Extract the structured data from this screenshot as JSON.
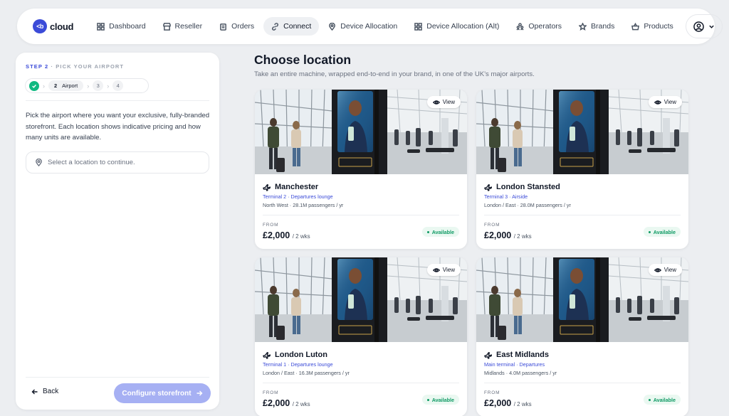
{
  "brand": {
    "logo_mark": "<b",
    "name": "cloud"
  },
  "nav": {
    "items": [
      {
        "label": "Dashboard",
        "icon": "grid-icon"
      },
      {
        "label": "Reseller",
        "icon": "store-icon"
      },
      {
        "label": "Orders",
        "icon": "clipboard-icon"
      },
      {
        "label": "Connect",
        "icon": "link-icon",
        "active": true
      },
      {
        "label": "Device Allocation",
        "icon": "map-pin-icon"
      },
      {
        "label": "Device Allocation (Alt)",
        "icon": "grid-icon"
      },
      {
        "label": "Operators",
        "icon": "users-icon"
      },
      {
        "label": "Brands",
        "icon": "star-icon"
      },
      {
        "label": "Products",
        "icon": "basket-icon"
      }
    ]
  },
  "sidebar": {
    "step_label": "STEP 2",
    "step_title": "PICK YOUR AIRPORT",
    "stepper": {
      "active_num": "2",
      "active_label": "Airport",
      "pending": [
        "3",
        "4"
      ]
    },
    "intro": "Pick the airport where you want your exclusive, fully-branded storefront. Each location shows indicative pricing and how many units are available.",
    "location_placeholder": "Select a location to continue.",
    "back_label": "Back",
    "configure_label": "Configure storefront"
  },
  "main": {
    "title": "Choose location",
    "subtitle": "Take an entire machine, wrapped end-to-end in your brand, in one of the UK's major airports."
  },
  "cards": [
    {
      "name": "Manchester",
      "terminal": "Terminal 2 · Departures lounge",
      "region": "North West · 28.1M passengers / yr",
      "from_label": "FROM",
      "price": "£2,000",
      "per": "/ 2 wks",
      "status": "Available",
      "view_label": "View"
    },
    {
      "name": "London Stansted",
      "terminal": "Terminal 3 · Airside",
      "region": "London / East · 28.0M passengers / yr",
      "from_label": "FROM",
      "price": "£2,000",
      "per": "/ 2 wks",
      "status": "Available",
      "view_label": "View"
    },
    {
      "name": "London Luton",
      "terminal": "Terminal 1 · Departures lounge",
      "region": "London / East · 16.3M passengers / yr",
      "from_label": "FROM",
      "price": "£2,000",
      "per": "/ 2 wks",
      "status": "Available",
      "view_label": "View"
    },
    {
      "name": "East Midlands",
      "terminal": "Main terminal · Departures",
      "region": "Midlands · 4.0M passengers / yr",
      "from_label": "FROM",
      "price": "£2,000",
      "per": "/ 2 wks",
      "status": "Available",
      "view_label": "View"
    }
  ],
  "colors": {
    "accent": "#3b4bd8",
    "available": "#0f9a64",
    "button_disabled": "#a6b0f3",
    "background": "#eceef1"
  }
}
